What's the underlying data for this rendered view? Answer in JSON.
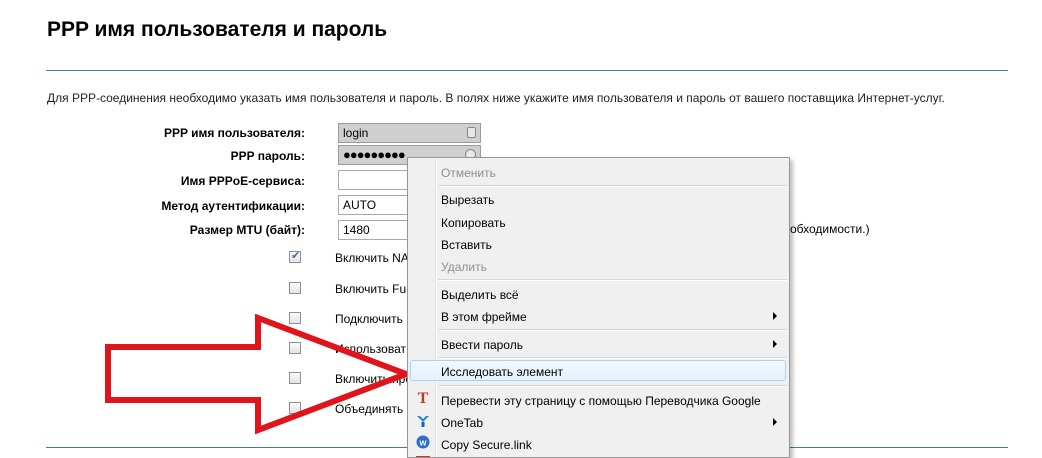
{
  "page": {
    "title": "PPP имя пользователя и пароль",
    "description": "Для PPP-соединения необходимо указать имя пользователя и пароль. В полях ниже укажите имя пользователя и пароль от вашего поставщика Интернет-услуг."
  },
  "form": {
    "username_label": "PPP имя пользователя:",
    "username_value": "login",
    "password_label": "PPP пароль:",
    "password_value": "●●●●●●●●●",
    "service_label": "Имя PPPoE-сервиса:",
    "service_value": "",
    "auth_label": "Метод аутентификации:",
    "auth_value": "AUTO",
    "mtu_label": "Размер MTU (байт):",
    "mtu_value": "1480",
    "mtu_suffix": "обходимости.)"
  },
  "options": [
    {
      "label": "Включить NA",
      "checked": true
    },
    {
      "label": "Включить Fu",
      "checked": false
    },
    {
      "label": "Подключить",
      "checked": false
    },
    {
      "label": "Использоват",
      "checked": false
    },
    {
      "label": "Включить пре",
      "checked": false
    },
    {
      "label": "Объединять",
      "checked": false
    }
  ],
  "context_menu": {
    "undo": "Отменить",
    "cut": "Вырезать",
    "copy": "Копировать",
    "paste": "Вставить",
    "delete": "Удалить",
    "select_all": "Выделить всё",
    "this_frame": "В этом фрейме",
    "enter_password": "Ввести пароль",
    "inspect": "Исследовать элемент",
    "translate": "Перевести эту страницу с помощью Переводчика Google",
    "onetab": "OneTab",
    "copy_secure": "Copy Secure.link"
  },
  "icons": {
    "translate": "translate-icon",
    "onetab": "onetab-icon",
    "secure_link": "secure-link-icon"
  },
  "colors": {
    "divider": "#3b7bbf",
    "arrow": "#e0141b",
    "menu_highlight": "#a8d2f5"
  }
}
